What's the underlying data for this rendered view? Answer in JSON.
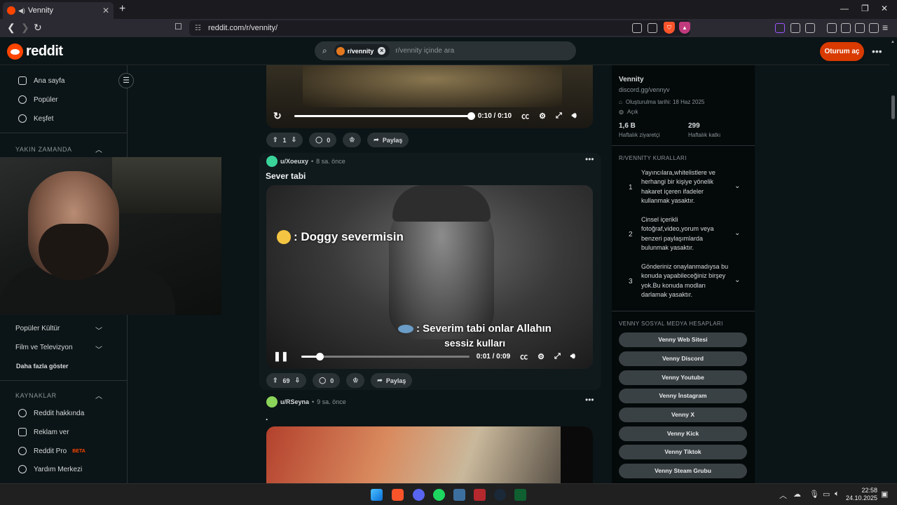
{
  "browser": {
    "tab_title": "Vennity",
    "url": "reddit.com/r/vennity/"
  },
  "header": {
    "logo_text": "reddit",
    "search_chip": "r/vennity",
    "search_placeholder": "r/vennity içinde ara",
    "login_label": "Oturum aç"
  },
  "left_nav": {
    "items": [
      {
        "label": "Ana sayfa",
        "icon": "home-icon"
      },
      {
        "label": "Popüler",
        "icon": "popular-icon"
      },
      {
        "label": "Keşfet",
        "icon": "explore-icon"
      }
    ],
    "recent_header": "YAKIN ZAMANDA",
    "topics": [
      {
        "label": "Popüler Kültür"
      },
      {
        "label": "Film ve Televizyon"
      }
    ],
    "more_label": "Daha fazla göster",
    "resources_header": "KAYNAKLAR",
    "resources": [
      {
        "label": "Reddit hakkında",
        "icon": "reddit-icon"
      },
      {
        "label": "Reklam ver",
        "icon": "megaphone-icon"
      },
      {
        "label": "Reddit Pro",
        "badge": "BETA",
        "icon": "pro-icon"
      },
      {
        "label": "Yardım Merkezi",
        "icon": "help-icon"
      }
    ]
  },
  "posts": [
    {
      "video": {
        "time": "0:10 / 0:10",
        "progress": 1.0
      },
      "votes": "1",
      "comments": "0",
      "share_label": "Paylaş"
    },
    {
      "author": "u/Xoeuxy",
      "age": "8 sa. önce",
      "title": "Sever tabi",
      "caption_1": ": Doggy severmisin",
      "caption_2": ": Severim tabi onlar Allahın",
      "caption_3": "sessiz kulları",
      "video": {
        "time": "0:01 / 0:09",
        "progress": 0.11
      },
      "votes": "69",
      "comments": "0",
      "share_label": "Paylaş"
    },
    {
      "author": "u/RSeyna",
      "age": "9 sa. önce",
      "title": "."
    }
  ],
  "community": {
    "name": "Vennity",
    "link": "discord.gg/vennyv",
    "created": "Oluşturulma tarihi: 18 Haz 2025",
    "visibility": "Açık",
    "stat1_value": "1,6 B",
    "stat1_label": "Haftalık ziyaretçi",
    "stat2_value": "299",
    "stat2_label": "Haftalık katkı",
    "rules_header": "R/VENNİTY KURALLARI",
    "rules": [
      {
        "n": "1",
        "text": "Yayıncılara,whitelistlere ve herhangi bir kişiye yönelik hakaret içeren ifadeler kullanmak yasaktır."
      },
      {
        "n": "2",
        "text": "Cinsel içerikli fotoğraf,video,yorum veya benzeri paylaşımlarda bulunmak yasaktır."
      },
      {
        "n": "3",
        "text": "Gönderiniz onaylanmadıysa bu konuda yapabileceğiniz birşey yok.Bu konuda modları darlamak yasaktır."
      }
    ],
    "social_header": "VENNY SOSYAL MEDYA HESAPLARI",
    "social_buttons": [
      "Venny Web Sitesi",
      "Venny Discord",
      "Venny Youtube",
      "Venny İnstagram",
      "Venny X",
      "Venny Kick",
      "Venny Tiktok",
      "Venny Steam Grubu"
    ]
  },
  "taskbar": {
    "time": "22:58",
    "date": "24.10.2025"
  },
  "colors": {
    "accent": "#d93a00",
    "reddit_orange": "#ff4500",
    "background": "#0b1416"
  }
}
